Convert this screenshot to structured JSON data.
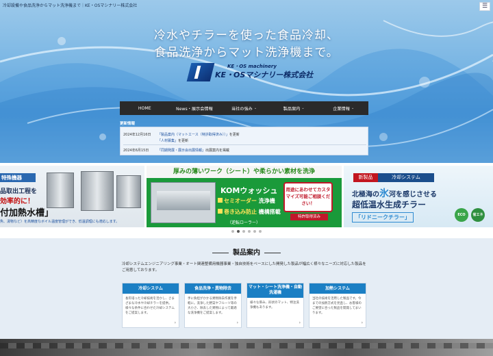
{
  "header": {
    "tagline": "冷却設備や食品洗浄からマット洗浄機まで｜KE・OSマシナリー株式会社",
    "menu_icon": "hamburger-icon"
  },
  "hero": {
    "line1": "冷水やチラーを使った食品冷却、",
    "line2": "食品洗浄からマット洗浄機まで。",
    "logo_sub": "KE・OS machinery",
    "logo_main": "KE・OSマシナリー株式会社"
  },
  "nav": {
    "items": [
      {
        "label": "HOME",
        "caret": ""
      },
      {
        "label": "News・展示会情報",
        "caret": ""
      },
      {
        "label": "当社の強み",
        "caret": "⌄"
      },
      {
        "label": "製品案内",
        "caret": "⌄"
      },
      {
        "label": "企業情報",
        "caret": "⌄"
      }
    ]
  },
  "news": {
    "title": "更新情報",
    "items": [
      {
        "date": "2024年12月16日",
        "link": "「製品案内（マットエース（特許取得済み））」",
        "suffix": "を更新"
      },
      {
        "date": "",
        "link": "「人材募集」",
        "suffix": "を更新"
      },
      {
        "date": "2024年6月15日",
        "link": "「同期発展・展示会出展情報」",
        "suffix": "出展案内を掲載"
      }
    ]
  },
  "banner1": {
    "tag": "特殊機器",
    "line1": "品取出工程を",
    "line2": "効率的に！",
    "line3": "付加熱水槽」",
    "line4": "魚、湯物など）を高精度なボイル温度管理ができ、低温調理にも適応します。"
  },
  "banner2": {
    "head": "厚みの薄いワーク（シート）や柔らかい素材を洗浄",
    "product": "KOMウォッシュ",
    "opt1a": "セミオーダー",
    "opt1b": "洗浄機",
    "opt2a": "巻き込み防止",
    "opt2b": "機構搭載",
    "bubble": "用途にあわせてカスタマイズ可能ご相談ください！",
    "patent": "特許取得済み",
    "small": "（逆転ローラー）"
  },
  "banner3": {
    "label1": "新製品",
    "label2": "冷却システム",
    "copy1a": "北極海の",
    "copy1b": "氷",
    "copy1c": "河を感じさせる",
    "copy2": "超低温水生成チラー",
    "copy3": "「リドニークチラー」",
    "eco1": "ECO",
    "eco2": "省エネ"
  },
  "slider": {
    "count": 6,
    "active_index": 1
  },
  "products": {
    "title": "製品案内",
    "intro": "冷却システムエンジニアリング事業・オート関連整備用機器事業・独自技術をベースにした開発した製品が幅広く様々なニーズに対応した製品をご用意しております。",
    "cards": [
      {
        "title": "冷却システム",
        "body": "長年培った冷却技術を活かし、さまざまな冷水や冷却チラーを提供。様々な条件に合わせた冷却システムをご提案します。"
      },
      {
        "title": "食品洗浄・異物除去",
        "body": "手に負担がかかる異物除去作業を手軽に。洗浄した野菜やフルーツ等の大小さ、除去した異物によって最適な洗浄機をご提案します。"
      },
      {
        "title": "マット・シート洗浄機・自動洗濯機",
        "body": "様々な厚み、形状のマット、特注洗浄機もあります。"
      },
      {
        "title": "加熱システム",
        "body": "当社の技術を活用した製品です。今までの加熱方式を見直し、お客様のご要望に合った製品を開発してまいります。"
      }
    ],
    "arrow": "›"
  },
  "colors": {
    "nav_bg": "#2a2a2a",
    "card_header": "#1b7fc4",
    "banner2_bg": "#1a9a3a",
    "accent_red": "#c2161f"
  }
}
